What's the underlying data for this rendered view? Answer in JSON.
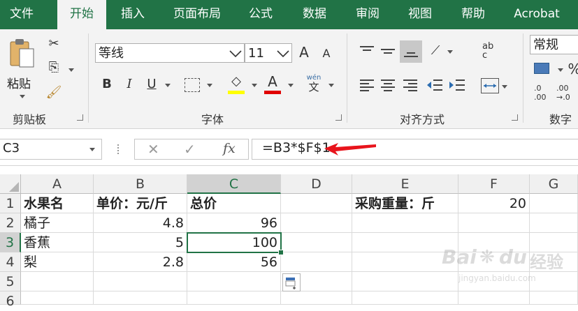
{
  "tabs": [
    "文件",
    "开始",
    "插入",
    "页面布局",
    "公式",
    "数据",
    "审阅",
    "视图",
    "帮助",
    "Acrobat"
  ],
  "active_tab": "开始",
  "ribbon": {
    "paste_label": "粘贴",
    "clipboard_group": "剪贴板",
    "font_group": "字体",
    "align_group": "对齐方式",
    "number_group": "数字",
    "font_name": "等线",
    "font_size": "11",
    "number_format": "常规",
    "bold": "B",
    "italic": "I",
    "underline": "U",
    "grow_font": "A",
    "shrink_font": "A",
    "font_color_glyph": "A",
    "phonetic_top": "wén",
    "phonetic_bottom": "文",
    "wrap_glyph": "ab\nc",
    "percent": "%",
    "dec_inc": ".0\n.00",
    "dec_dec": ".00\n→.0",
    "highlight_color": "#ffff00",
    "font_color": "#e00000"
  },
  "formula_bar": {
    "name_box": "C3",
    "cancel": "✕",
    "enter": "✓",
    "fx": "fx",
    "formula": "=B3*$F$1",
    "arrow_color": "#e8141c"
  },
  "grid": {
    "columns": [
      "A",
      "B",
      "C",
      "D",
      "E",
      "F",
      "G"
    ],
    "rows": [
      "1",
      "2",
      "3",
      "4",
      "5",
      "6"
    ],
    "selected_column": "C",
    "selected_row": "3",
    "cells": {
      "A1": "水果名",
      "B1": "单价：元/斤",
      "C1": "总价",
      "E1": "采购重量：斤",
      "F1": "20",
      "A2": "橘子",
      "B2": "4.8",
      "C2": "96",
      "A3": "香蕉",
      "B3": "5",
      "C3": "100",
      "A4": "梨",
      "B4": "2.8",
      "C4": "56"
    },
    "accent": "#217346"
  },
  "watermark": {
    "brand": "Bai",
    "brand2": "du",
    "suffix": "经验",
    "url": "jingyan.baidu.com"
  }
}
